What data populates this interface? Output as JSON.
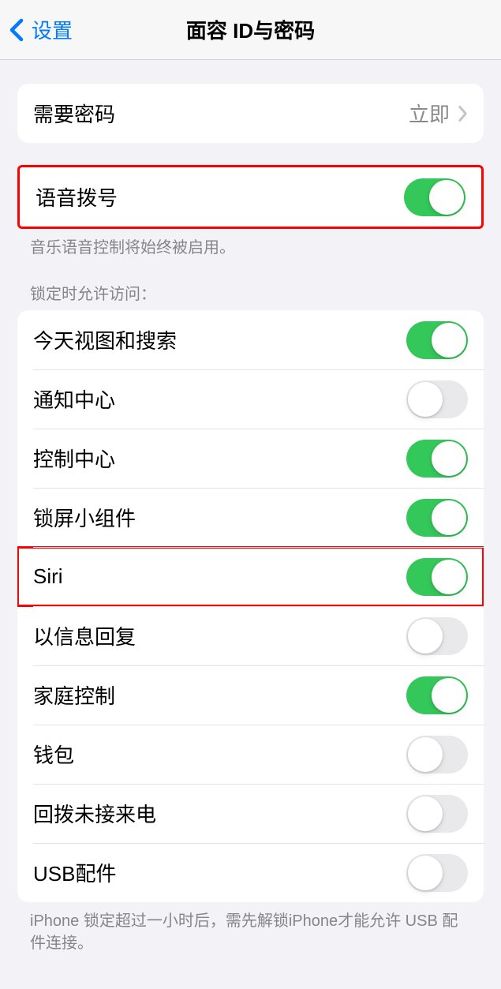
{
  "nav": {
    "back": "设置",
    "title": "面容 ID与密码"
  },
  "passcode": {
    "label": "需要密码",
    "value": "立即"
  },
  "voiceDial": {
    "label": "语音拨号",
    "on": true,
    "footer": "音乐语音控制将始终被启用。"
  },
  "lockAccess": {
    "header": "锁定时允许访问：",
    "items": [
      {
        "key": "today",
        "label": "今天视图和搜索",
        "on": true
      },
      {
        "key": "notification",
        "label": "通知中心",
        "on": false
      },
      {
        "key": "control",
        "label": "控制中心",
        "on": true
      },
      {
        "key": "widgets",
        "label": "锁屏小组件",
        "on": true
      },
      {
        "key": "siri",
        "label": "Siri",
        "on": true,
        "highlight": true
      },
      {
        "key": "reply",
        "label": "以信息回复",
        "on": false
      },
      {
        "key": "home",
        "label": "家庭控制",
        "on": true
      },
      {
        "key": "wallet",
        "label": "钱包",
        "on": false
      },
      {
        "key": "callback",
        "label": "回拨未接来电",
        "on": false
      },
      {
        "key": "usb",
        "label": "USB配件",
        "on": false
      }
    ],
    "footer": "iPhone 锁定超过一小时后，需先解锁iPhone才能允许 USB 配件连接。"
  }
}
